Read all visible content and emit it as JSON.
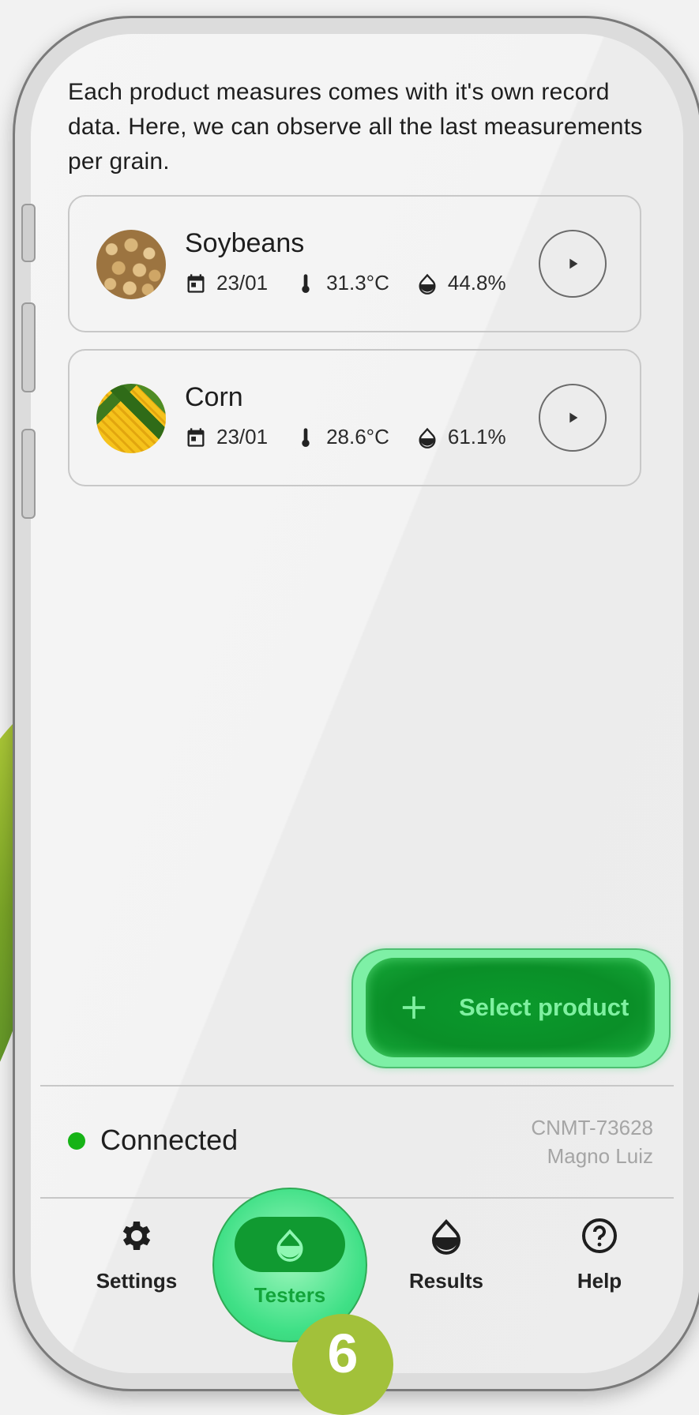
{
  "intro_text": "Each product measures comes with it's own record data. Here, we can observe all the last measurements per grain.",
  "products": [
    {
      "name": "Soybeans",
      "date": "23/01",
      "temperature": "31.3°C",
      "humidity": "44.8%",
      "thumbnail": "soybeans-image"
    },
    {
      "name": "Corn",
      "date": "23/01",
      "temperature": "28.6°C",
      "humidity": "61.1%",
      "thumbnail": "corn-image"
    }
  ],
  "fab": {
    "label": "Select product",
    "icon": "plus-icon"
  },
  "status": {
    "label": "Connected",
    "color": "#16b316",
    "device_id": "CNMT-73628",
    "user": "Magno Luiz"
  },
  "nav": [
    {
      "label": "Settings",
      "icon": "gear-icon"
    },
    {
      "label": "Testers",
      "icon": "drop-half-icon",
      "active": true
    },
    {
      "label": "Results",
      "icon": "drop-half-icon"
    },
    {
      "label": "Help",
      "icon": "help-circle-icon"
    }
  ],
  "step_badge": "6",
  "colors": {
    "accent": "#0a8f28",
    "accent_light": "#7ef0a6",
    "badge": "#a2c13a"
  }
}
